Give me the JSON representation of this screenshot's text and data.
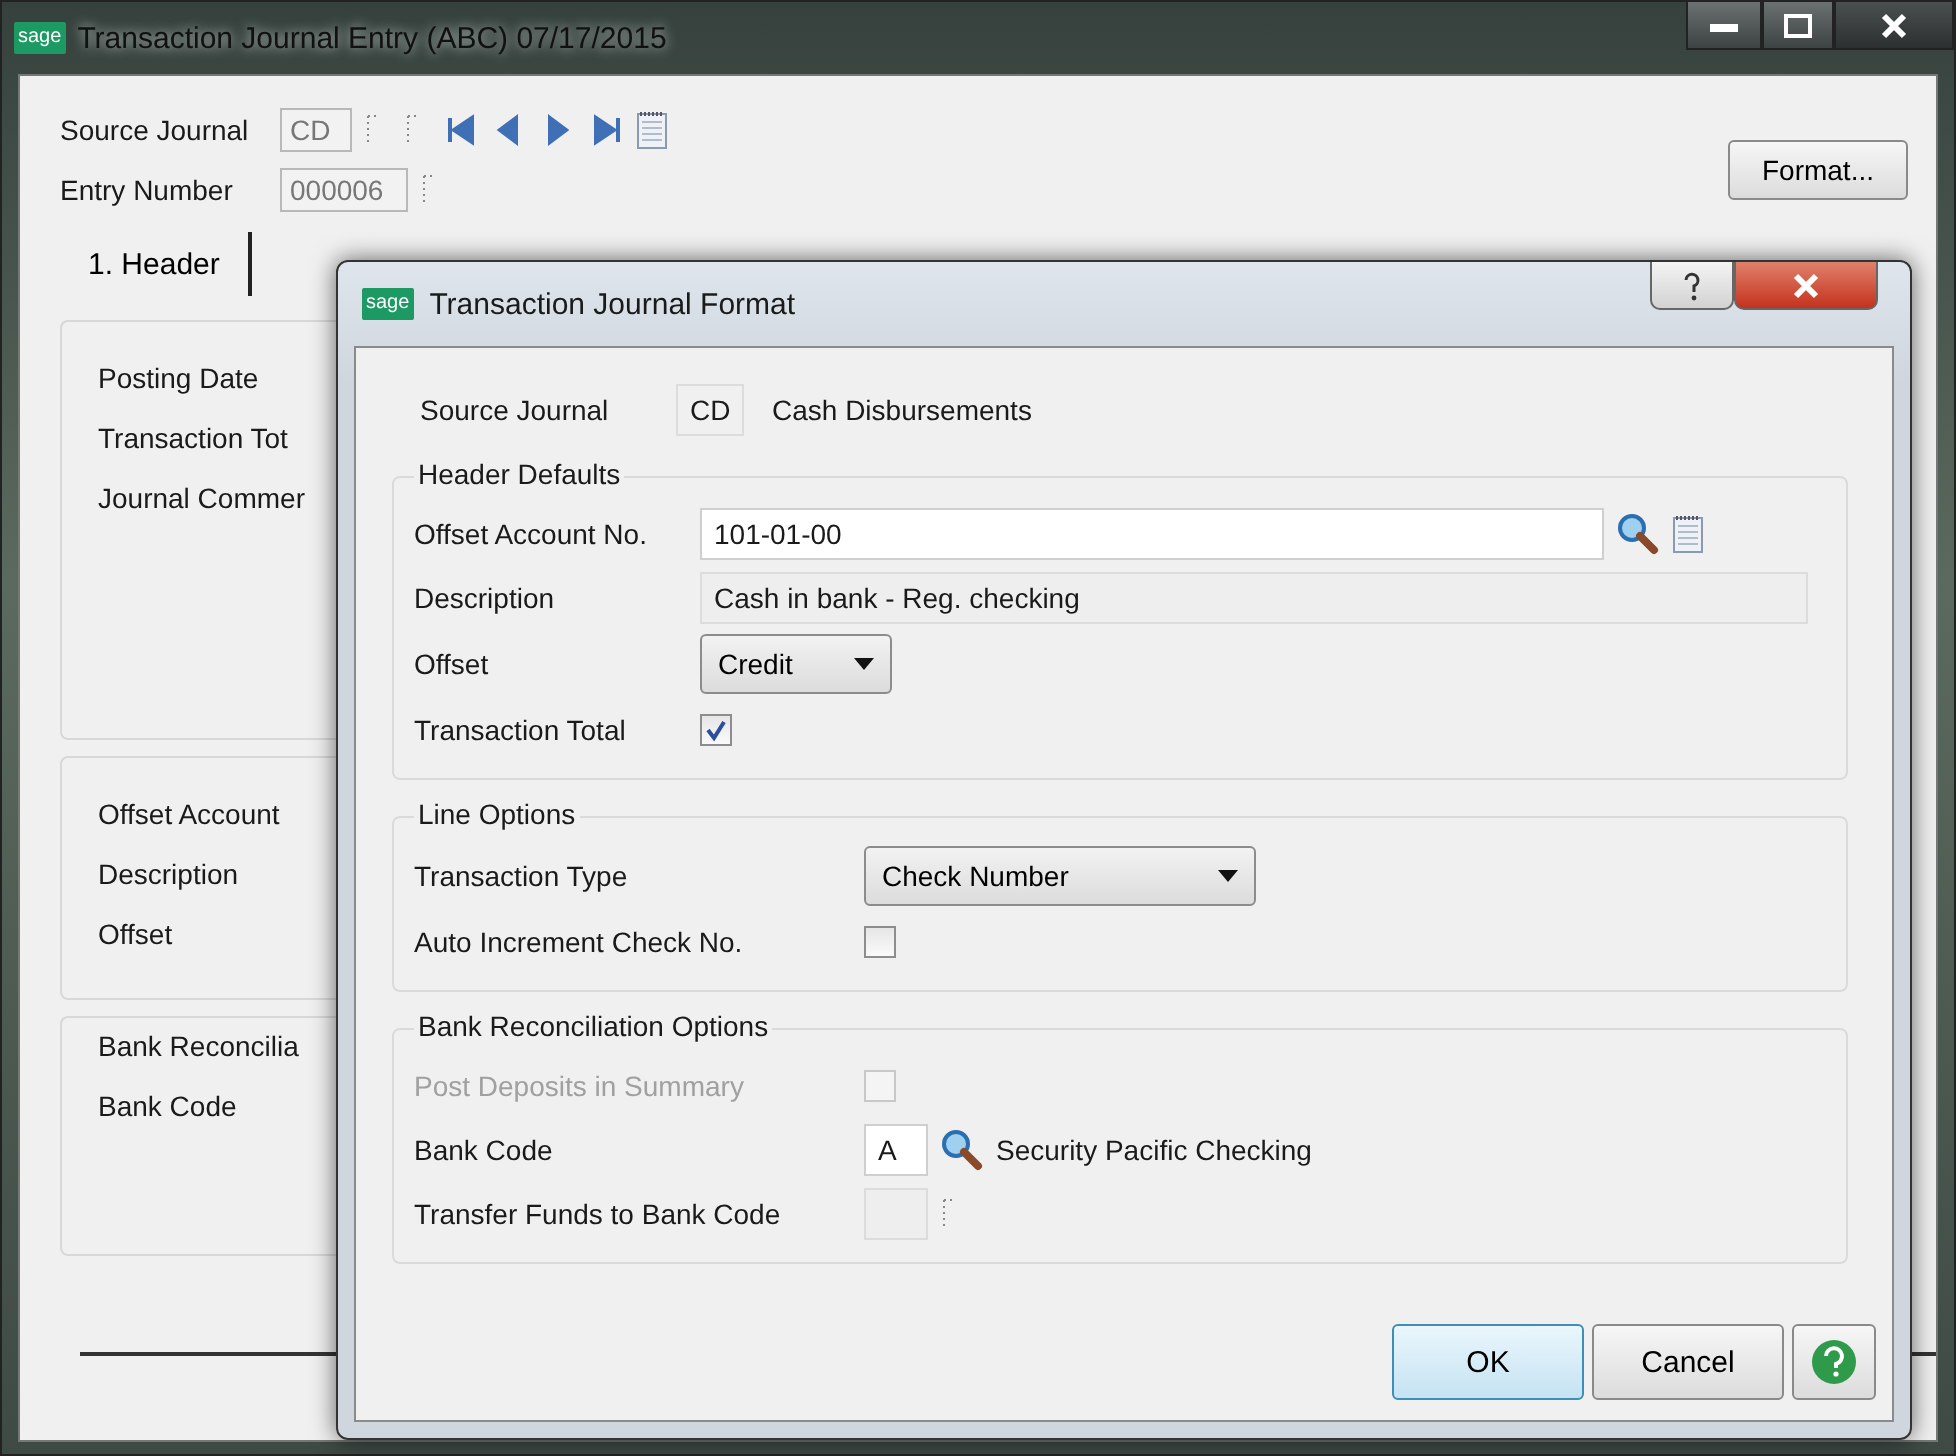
{
  "window": {
    "logo": "sage",
    "title": "Transaction Journal Entry (ABC) 07/17/2015"
  },
  "toolbar": {
    "source_label": "Source Journal",
    "source_value": "CD",
    "entry_label": "Entry Number",
    "entry_value": "000006",
    "format_button": "Format..."
  },
  "tabs": [
    {
      "label": "1. Header",
      "selected": true
    }
  ],
  "header_fields": [
    "Posting Date",
    "Transaction Tot",
    "Journal Commer"
  ],
  "offset_fields": [
    "Offset Account",
    "Description",
    "Offset"
  ],
  "bank_group": {
    "title": "Bank Reconcilia",
    "fields": [
      "Bank Code"
    ]
  },
  "dialog": {
    "logo": "sage",
    "title": "Transaction Journal Format",
    "source": {
      "label": "Source Journal",
      "code": "CD",
      "name": "Cash Disbursements"
    },
    "groups": [
      {
        "title": "Header Defaults",
        "rows": [
          {
            "kind": "lookup",
            "label": "Offset Account No.",
            "value": "101-01-00"
          },
          {
            "kind": "readonly",
            "label": "Description",
            "value": "Cash in bank - Reg. checking"
          },
          {
            "kind": "select",
            "label": "Offset",
            "value": "Credit"
          },
          {
            "kind": "checkbox",
            "label": "Transaction Total",
            "checked": true,
            "disabled": false
          }
        ]
      },
      {
        "title": "Line Options",
        "rows": [
          {
            "kind": "select",
            "label": "Transaction Type",
            "value": "Check Number"
          },
          {
            "kind": "checkbox",
            "label": "Auto Increment Check No.",
            "checked": false,
            "disabled": false
          }
        ]
      },
      {
        "title": "Bank Reconciliation Options",
        "rows": [
          {
            "kind": "checkbox",
            "label": "Post Deposits in Summary",
            "checked": false,
            "disabled": true
          },
          {
            "kind": "code",
            "label": "Bank Code",
            "value": "A",
            "name": "Security Pacific Checking"
          },
          {
            "kind": "code",
            "label": "Transfer Funds to Bank Code"
          }
        ]
      }
    ],
    "buttons": [
      "OK",
      "Cancel"
    ]
  }
}
